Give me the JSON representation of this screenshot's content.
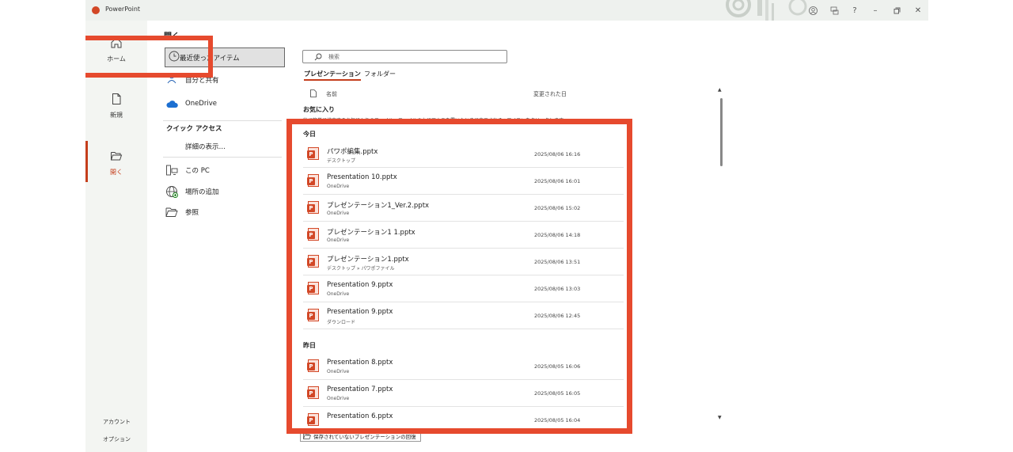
{
  "titlebar": {
    "app_name": "PowerPoint"
  },
  "leftnav": {
    "home": "ホーム",
    "new": "新規",
    "open": "開く",
    "account": "アカウント",
    "options": "オプション"
  },
  "sidebar": {
    "heading": "開く",
    "recent": "最近使ったアイテム",
    "shared": "自分と共有",
    "onedrive": "OneDrive",
    "quick_access": "クイック アクセス",
    "show_more": "詳細の表示…",
    "this_pc": "この PC",
    "add_place": "場所の追加",
    "browse": "参照"
  },
  "main": {
    "search_placeholder": "検索",
    "tabs": [
      "プレゼンテーション",
      "フォルダー"
    ],
    "col_name": "名前",
    "col_modified": "変更された日",
    "favorites_title": "お気に入り",
    "favorites_desc": "後で簡単に検索するお気に入りのファイル。ファイルの上にマウスを置いたときに表示される☆アイコンをクリックします。",
    "group_today": "今日",
    "group_yesterday": "昨日",
    "recover_button": "保存されていないプレゼンテーションの回復"
  },
  "files_today": [
    {
      "name": "パワポ編集.pptx",
      "location": "デスクトップ",
      "date": "2025/08/06 16:16"
    },
    {
      "name": "Presentation 10.pptx",
      "location": "OneDrive",
      "date": "2025/08/06 16:01"
    },
    {
      "name": "プレゼンテーション1_Ver.2.pptx",
      "location": "OneDrive",
      "date": "2025/08/06 15:02"
    },
    {
      "name": "プレゼンテーション1 1.pptx",
      "location": "OneDrive",
      "date": "2025/08/06 14:18"
    },
    {
      "name": "プレゼンテーション1.pptx",
      "location": "デスクトップ » パワポファイル",
      "date": "2025/08/06 13:51"
    },
    {
      "name": "Presentation 9.pptx",
      "location": "OneDrive",
      "date": "2025/08/06 13:03"
    },
    {
      "name": "Presentation 9.pptx",
      "location": "ダウンロード",
      "date": "2025/08/06 12:45"
    }
  ],
  "files_yesterday": [
    {
      "name": "Presentation 8.pptx",
      "location": "OneDrive",
      "date": "2025/08/05 16:06"
    },
    {
      "name": "Presentation 7.pptx",
      "location": "OneDrive",
      "date": "2025/08/05 16:05"
    },
    {
      "name": "Presentation 6.pptx",
      "location": "",
      "date": "2025/08/05 16:04"
    }
  ],
  "colors": {
    "accent": "#c43e1c",
    "highlight": "#e64a2e"
  },
  "icons": {
    "app": "powerpoint-icon",
    "home": "home-icon",
    "new": "new-document-icon",
    "open": "folder-open-icon",
    "recent": "clock-icon",
    "shared": "person-icon",
    "onedrive": "cloud-icon",
    "pc": "computer-icon",
    "add_place": "globe-icon",
    "browse": "folder-icon",
    "search": "search-icon",
    "file": "pptx-file-icon"
  }
}
